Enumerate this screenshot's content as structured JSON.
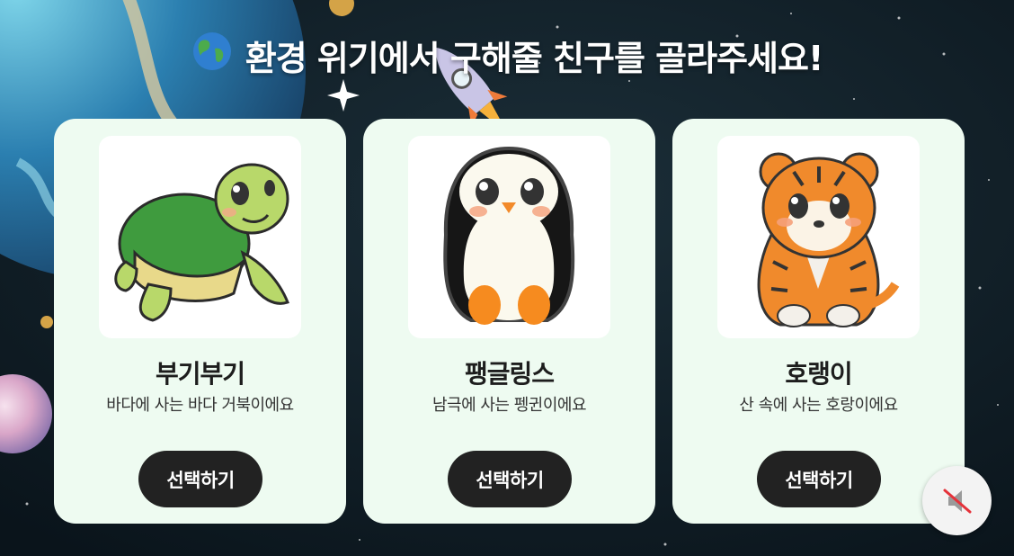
{
  "page": {
    "title": "환경 위기에서 구해줄 친구를 골라주세요!",
    "title_icon": "globe-icon"
  },
  "characters": [
    {
      "name": "부기부기",
      "description": "바다에 사는 바다 거북이에요",
      "button_label": "선택하기",
      "icon": "turtle-illustration"
    },
    {
      "name": "팽글링스",
      "description": "남극에 사는 펭귄이에요",
      "button_label": "선택하기",
      "icon": "penguin-illustration"
    },
    {
      "name": "호랭이",
      "description": "산 속에 사는 호랑이에요",
      "button_label": "선택하기",
      "icon": "tiger-illustration"
    }
  ],
  "sound_toggle": {
    "icon": "speaker-muted-icon",
    "state": "muted"
  },
  "colors": {
    "background": "#0d1b24",
    "card_background": "#eefbf1",
    "button_background": "#222222",
    "button_text": "#ffffff",
    "title_text": "#ffffff"
  }
}
